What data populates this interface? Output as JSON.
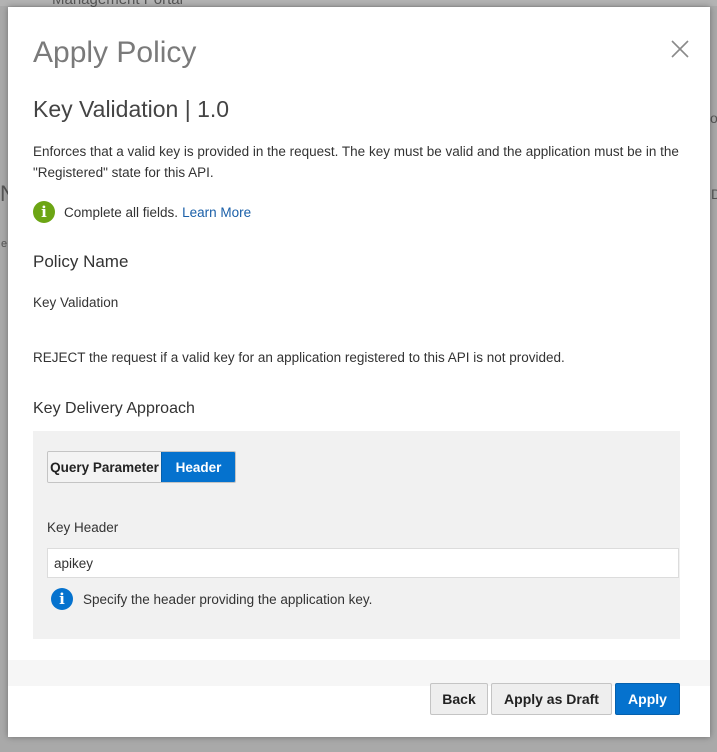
{
  "background": {
    "app_title": "Management Portal",
    "fragments": [
      "ow",
      "D",
      "N",
      "e"
    ]
  },
  "modal": {
    "title": "Apply Policy",
    "subtitle": "Key Validation | 1.0",
    "description": "Enforces that a valid key is provided in the request. The key must be valid and the application must be in the \"Registered\" state for this API.",
    "info_text": "Complete all fields.",
    "info_link": "Learn More",
    "policy_name_heading": "Policy Name",
    "policy_name_value": "Key Validation",
    "reject_text": "REJECT the request if a valid key for an application registered to this API is not provided.",
    "key_delivery_heading": "Key Delivery Approach",
    "segments": [
      {
        "label": "Query Parameter",
        "selected": false
      },
      {
        "label": "Header",
        "selected": true
      }
    ],
    "key_header_label": "Key Header",
    "key_header_value": "apikey",
    "key_header_hint": "Specify the header providing the application key."
  },
  "footer": {
    "back_label": "Back",
    "draft_label": "Apply as Draft",
    "apply_label": "Apply"
  },
  "icons": {
    "close": "close-icon",
    "info_green": "info-icon",
    "info_blue": "info-icon"
  },
  "colors": {
    "primary": "#0572ce",
    "info_green": "#6ca514",
    "link": "#1a5fa8",
    "panel": "#f1f1f1"
  }
}
